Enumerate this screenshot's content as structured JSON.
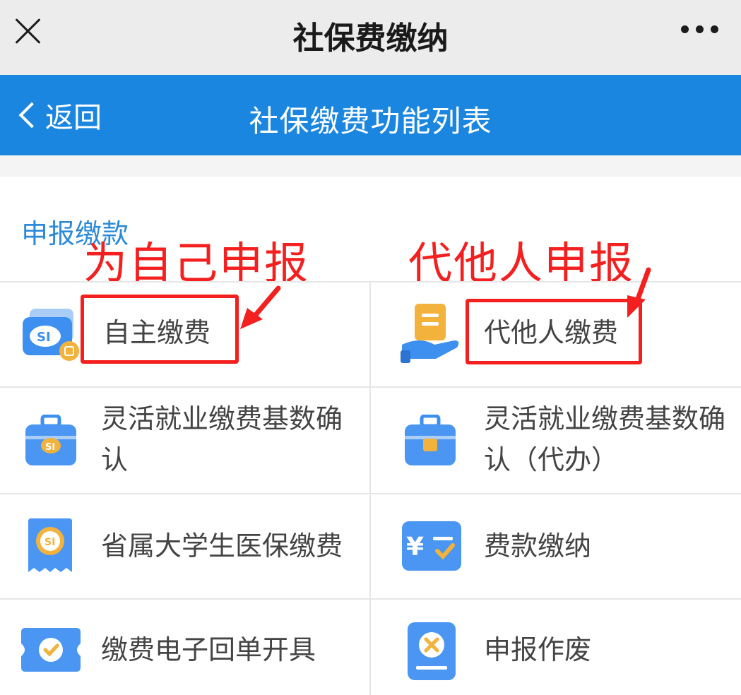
{
  "window": {
    "title": "社保费缴纳",
    "close_icon": "close-icon",
    "more_icon": "more-dots-icon"
  },
  "navbar": {
    "back_label": "返回",
    "title": "社保缴费功能列表"
  },
  "section": {
    "title": "申报缴款"
  },
  "annotations": {
    "self": "为自己申报",
    "others": "代他人申报",
    "color": "#f41f1f"
  },
  "items": [
    {
      "label": "自主缴费",
      "icon": "si-card-icon"
    },
    {
      "label": "代他人缴费",
      "icon": "hand-document-icon"
    },
    {
      "label": "灵活就业缴费基数确认",
      "icon": "briefcase-si-icon"
    },
    {
      "label": "灵活就业缴费基数确认（代办）",
      "icon": "briefcase-icon"
    },
    {
      "label": "省属大学生医保缴费",
      "icon": "receipt-si-icon"
    },
    {
      "label": "费款缴纳",
      "icon": "yen-payment-icon"
    },
    {
      "label": "缴费电子回单开具",
      "icon": "ticket-check-icon"
    },
    {
      "label": "申报作废",
      "icon": "document-cancel-icon"
    }
  ],
  "colors": {
    "navbar": "#1a86e0",
    "accent": "#2b8ad8",
    "annotation": "#f41f1f"
  }
}
